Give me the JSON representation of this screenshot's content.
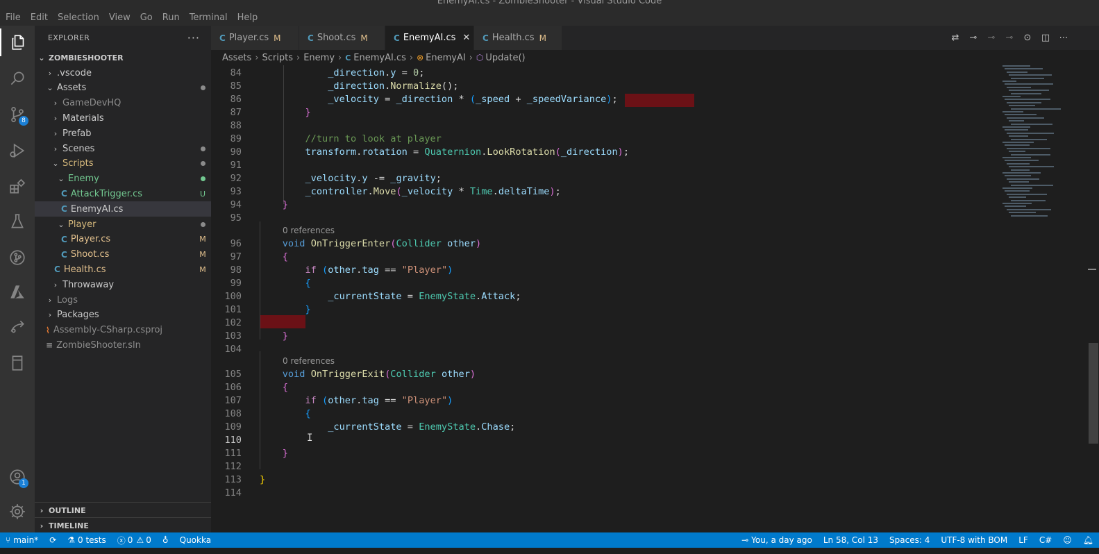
{
  "window": {
    "title": "EnemyAI.cs - ZombieShooter - Visual Studio Code"
  },
  "menu": [
    "File",
    "Edit",
    "Selection",
    "View",
    "Go",
    "Run",
    "Terminal",
    "Help"
  ],
  "activity": {
    "source_control_badge": "8",
    "accounts_badge": "1"
  },
  "explorer": {
    "header": "EXPLORER",
    "more": "···",
    "root": "ZOMBIESHOOTER",
    "items": [
      {
        "label": ".vscode",
        "chev": "›",
        "color": "#cccccc",
        "deco": ""
      },
      {
        "label": "Assets",
        "chev": "⌄",
        "color": "#cccccc",
        "deco": "dot-gray"
      },
      {
        "label": "GameDevHQ",
        "chev": "›",
        "color": "#8c8c8c",
        "deco": ""
      },
      {
        "label": "Materials",
        "chev": "›",
        "color": "#cccccc",
        "deco": ""
      },
      {
        "label": "Prefab",
        "chev": "›",
        "color": "#cccccc",
        "deco": ""
      },
      {
        "label": "Scenes",
        "chev": "›",
        "color": "#cccccc",
        "deco": "dot-gray"
      },
      {
        "label": "Scripts",
        "chev": "⌄",
        "color": "#d7ba7d",
        "deco": "dot-gray"
      },
      {
        "label": "Enemy",
        "chev": "⌄",
        "color": "#73c991",
        "deco": "dot-green"
      },
      {
        "label": "AttackTrigger.cs",
        "icon": "C#",
        "color": "#73c991",
        "deco": "U"
      },
      {
        "label": "EnemyAI.cs",
        "icon": "C#",
        "color": "#cccccc",
        "deco": ""
      },
      {
        "label": "Player",
        "chev": "⌄",
        "color": "#d7ba7d",
        "deco": "dot-gray"
      },
      {
        "label": "Player.cs",
        "icon": "C#",
        "color": "#e2c08d",
        "deco": "M"
      },
      {
        "label": "Shoot.cs",
        "icon": "C#",
        "color": "#e2c08d",
        "deco": "M"
      },
      {
        "label": "Health.cs",
        "icon": "C#",
        "color": "#e2c08d",
        "deco": "M"
      },
      {
        "label": "Throwaway",
        "chev": "›",
        "color": "#cccccc",
        "deco": ""
      },
      {
        "label": "Logs",
        "chev": "›",
        "color": "#8c8c8c",
        "deco": ""
      },
      {
        "label": "Packages",
        "chev": "›",
        "color": "#cccccc",
        "deco": ""
      },
      {
        "label": "Assembly-CSharp.csproj",
        "icon": "rss",
        "color": "#8c8c8c",
        "deco": ""
      },
      {
        "label": "ZombieShooter.sln",
        "icon": "≡",
        "color": "#8c8c8c",
        "deco": ""
      }
    ],
    "outline": "OUTLINE",
    "timeline": "TIMELINE"
  },
  "tabs": [
    {
      "label": "Player.cs",
      "modified": "M",
      "active": false
    },
    {
      "label": "Shoot.cs",
      "modified": "M",
      "active": false
    },
    {
      "label": "EnemyAI.cs",
      "modified": "",
      "active": true
    },
    {
      "label": "Health.cs",
      "modified": "M",
      "active": false
    }
  ],
  "breadcrumb": [
    "Assets",
    "Scripts",
    "Enemy",
    "EnemyAI.cs",
    "EnemyAI",
    "Update()"
  ],
  "code": {
    "lines": [
      {
        "n": "84",
        "tokens": [
          [
            "            ",
            "p"
          ],
          [
            "_direction",
            "v"
          ],
          [
            ".",
            "p"
          ],
          [
            "y",
            "v"
          ],
          [
            " = ",
            "p"
          ],
          [
            "0",
            "n"
          ],
          [
            ";",
            "p"
          ]
        ]
      },
      {
        "n": "85",
        "tokens": [
          [
            "            ",
            "p"
          ],
          [
            "_direction",
            "v"
          ],
          [
            ".",
            "p"
          ],
          [
            "Normalize",
            "f"
          ],
          [
            "()",
            "p"
          ],
          [
            ";",
            "p"
          ]
        ]
      },
      {
        "n": "86",
        "tokens": [
          [
            "            ",
            "p"
          ],
          [
            "_velocity",
            "v"
          ],
          [
            " = ",
            "p"
          ],
          [
            "_direction",
            "v"
          ],
          [
            " * ",
            "p"
          ],
          [
            "(",
            "b3"
          ],
          [
            "_speed",
            "v"
          ],
          [
            " + ",
            "p"
          ],
          [
            "_speedVariance",
            "v"
          ],
          [
            ")",
            "b3"
          ],
          [
            ";",
            "p"
          ]
        ]
      },
      {
        "n": "87",
        "tokens": [
          [
            "        ",
            "p"
          ],
          [
            "}",
            "b2"
          ]
        ]
      },
      {
        "n": "88",
        "tokens": []
      },
      {
        "n": "89",
        "tokens": [
          [
            "        ",
            "p"
          ],
          [
            "//turn to look at player",
            "c"
          ]
        ]
      },
      {
        "n": "90",
        "tokens": [
          [
            "        ",
            "p"
          ],
          [
            "transform",
            "v"
          ],
          [
            ".",
            "p"
          ],
          [
            "rotation",
            "v"
          ],
          [
            " = ",
            "p"
          ],
          [
            "Quaternion",
            "t"
          ],
          [
            ".",
            "p"
          ],
          [
            "LookRotation",
            "f"
          ],
          [
            "(",
            "b2"
          ],
          [
            "_direction",
            "v"
          ],
          [
            ")",
            "b2"
          ],
          [
            ";",
            "p"
          ]
        ]
      },
      {
        "n": "91",
        "tokens": []
      },
      {
        "n": "92",
        "tokens": [
          [
            "        ",
            "p"
          ],
          [
            "_velocity",
            "v"
          ],
          [
            ".",
            "p"
          ],
          [
            "y",
            "v"
          ],
          [
            " -= ",
            "p"
          ],
          [
            "_gravity",
            "v"
          ],
          [
            ";",
            "p"
          ]
        ]
      },
      {
        "n": "93",
        "tokens": [
          [
            "        ",
            "p"
          ],
          [
            "_controller",
            "v"
          ],
          [
            ".",
            "p"
          ],
          [
            "Move",
            "f"
          ],
          [
            "(",
            "b2"
          ],
          [
            "_velocity",
            "v"
          ],
          [
            " * ",
            "p"
          ],
          [
            "Time",
            "t"
          ],
          [
            ".",
            "p"
          ],
          [
            "deltaTime",
            "v"
          ],
          [
            ")",
            "b2"
          ],
          [
            ";",
            "p"
          ]
        ]
      },
      {
        "n": "94",
        "tokens": [
          [
            "    ",
            "p"
          ],
          [
            "}",
            "b2"
          ]
        ]
      },
      {
        "n": "95",
        "tokens": []
      },
      {
        "n": "96",
        "lens": "0 references",
        "tokens": [
          [
            "    ",
            "p"
          ],
          [
            "void",
            "k"
          ],
          [
            " ",
            "p"
          ],
          [
            "OnTriggerEnter",
            "f"
          ],
          [
            "(",
            "b2"
          ],
          [
            "Collider",
            "t"
          ],
          [
            " ",
            "p"
          ],
          [
            "other",
            "v"
          ],
          [
            ")",
            "b2"
          ]
        ]
      },
      {
        "n": "97",
        "tokens": [
          [
            "    ",
            "p"
          ],
          [
            "{",
            "b2"
          ]
        ]
      },
      {
        "n": "98",
        "tokens": [
          [
            "        ",
            "p"
          ],
          [
            "if",
            "kc"
          ],
          [
            " ",
            "p"
          ],
          [
            "(",
            "b3"
          ],
          [
            "other",
            "v"
          ],
          [
            ".",
            "p"
          ],
          [
            "tag",
            "v"
          ],
          [
            " == ",
            "p"
          ],
          [
            "\"Player\"",
            "s"
          ],
          [
            ")",
            "b3"
          ]
        ]
      },
      {
        "n": "99",
        "tokens": [
          [
            "        ",
            "p"
          ],
          [
            "{",
            "b3"
          ]
        ]
      },
      {
        "n": "100",
        "tokens": [
          [
            "            ",
            "p"
          ],
          [
            "_currentState",
            "v"
          ],
          [
            " = ",
            "p"
          ],
          [
            "EnemyState",
            "t"
          ],
          [
            ".",
            "p"
          ],
          [
            "Attack",
            "v"
          ],
          [
            ";",
            "p"
          ]
        ]
      },
      {
        "n": "101",
        "tokens": [
          [
            "        ",
            "p"
          ],
          [
            "}",
            "b3"
          ]
        ]
      },
      {
        "n": "102",
        "tokens": []
      },
      {
        "n": "103",
        "tokens": [
          [
            "    ",
            "p"
          ],
          [
            "}",
            "b2"
          ]
        ]
      },
      {
        "n": "104",
        "tokens": []
      },
      {
        "n": "105",
        "lens": "0 references",
        "tokens": [
          [
            "    ",
            "p"
          ],
          [
            "void",
            "k"
          ],
          [
            " ",
            "p"
          ],
          [
            "OnTriggerExit",
            "f"
          ],
          [
            "(",
            "b2"
          ],
          [
            "Collider",
            "t"
          ],
          [
            " ",
            "p"
          ],
          [
            "other",
            "v"
          ],
          [
            ")",
            "b2"
          ]
        ]
      },
      {
        "n": "106",
        "tokens": [
          [
            "    ",
            "p"
          ],
          [
            "{",
            "b2"
          ]
        ]
      },
      {
        "n": "107",
        "tokens": [
          [
            "        ",
            "p"
          ],
          [
            "if",
            "kc"
          ],
          [
            " ",
            "p"
          ],
          [
            "(",
            "b3"
          ],
          [
            "other",
            "v"
          ],
          [
            ".",
            "p"
          ],
          [
            "tag",
            "v"
          ],
          [
            " == ",
            "p"
          ],
          [
            "\"Player\"",
            "s"
          ],
          [
            ")",
            "b3"
          ]
        ]
      },
      {
        "n": "108",
        "tokens": [
          [
            "        ",
            "p"
          ],
          [
            "{",
            "b3"
          ]
        ]
      },
      {
        "n": "109",
        "tokens": [
          [
            "            ",
            "p"
          ],
          [
            "_currentState",
            "v"
          ],
          [
            " = ",
            "p"
          ],
          [
            "EnemyState",
            "t"
          ],
          [
            ".",
            "p"
          ],
          [
            "Chase",
            "v"
          ],
          [
            ";",
            "p"
          ]
        ]
      },
      {
        "n": "110",
        "tokens": []
      },
      {
        "n": "111",
        "tokens": [
          [
            "    ",
            "p"
          ],
          [
            "}",
            "b2"
          ]
        ]
      },
      {
        "n": "112",
        "tokens": []
      },
      {
        "n": "113",
        "tokens": [
          [
            "}",
            "b1"
          ]
        ]
      },
      {
        "n": "114",
        "tokens": []
      }
    ]
  },
  "status": {
    "branch": "main*",
    "tests": "0 tests",
    "errors": "0",
    "warnings": "0",
    "quokka": "Quokka",
    "blame": "You, a day ago",
    "position": "Ln 58, Col 13",
    "spaces": "Spaces: 4",
    "encoding": "UTF-8 with BOM",
    "eol": "LF",
    "language": "C#"
  }
}
